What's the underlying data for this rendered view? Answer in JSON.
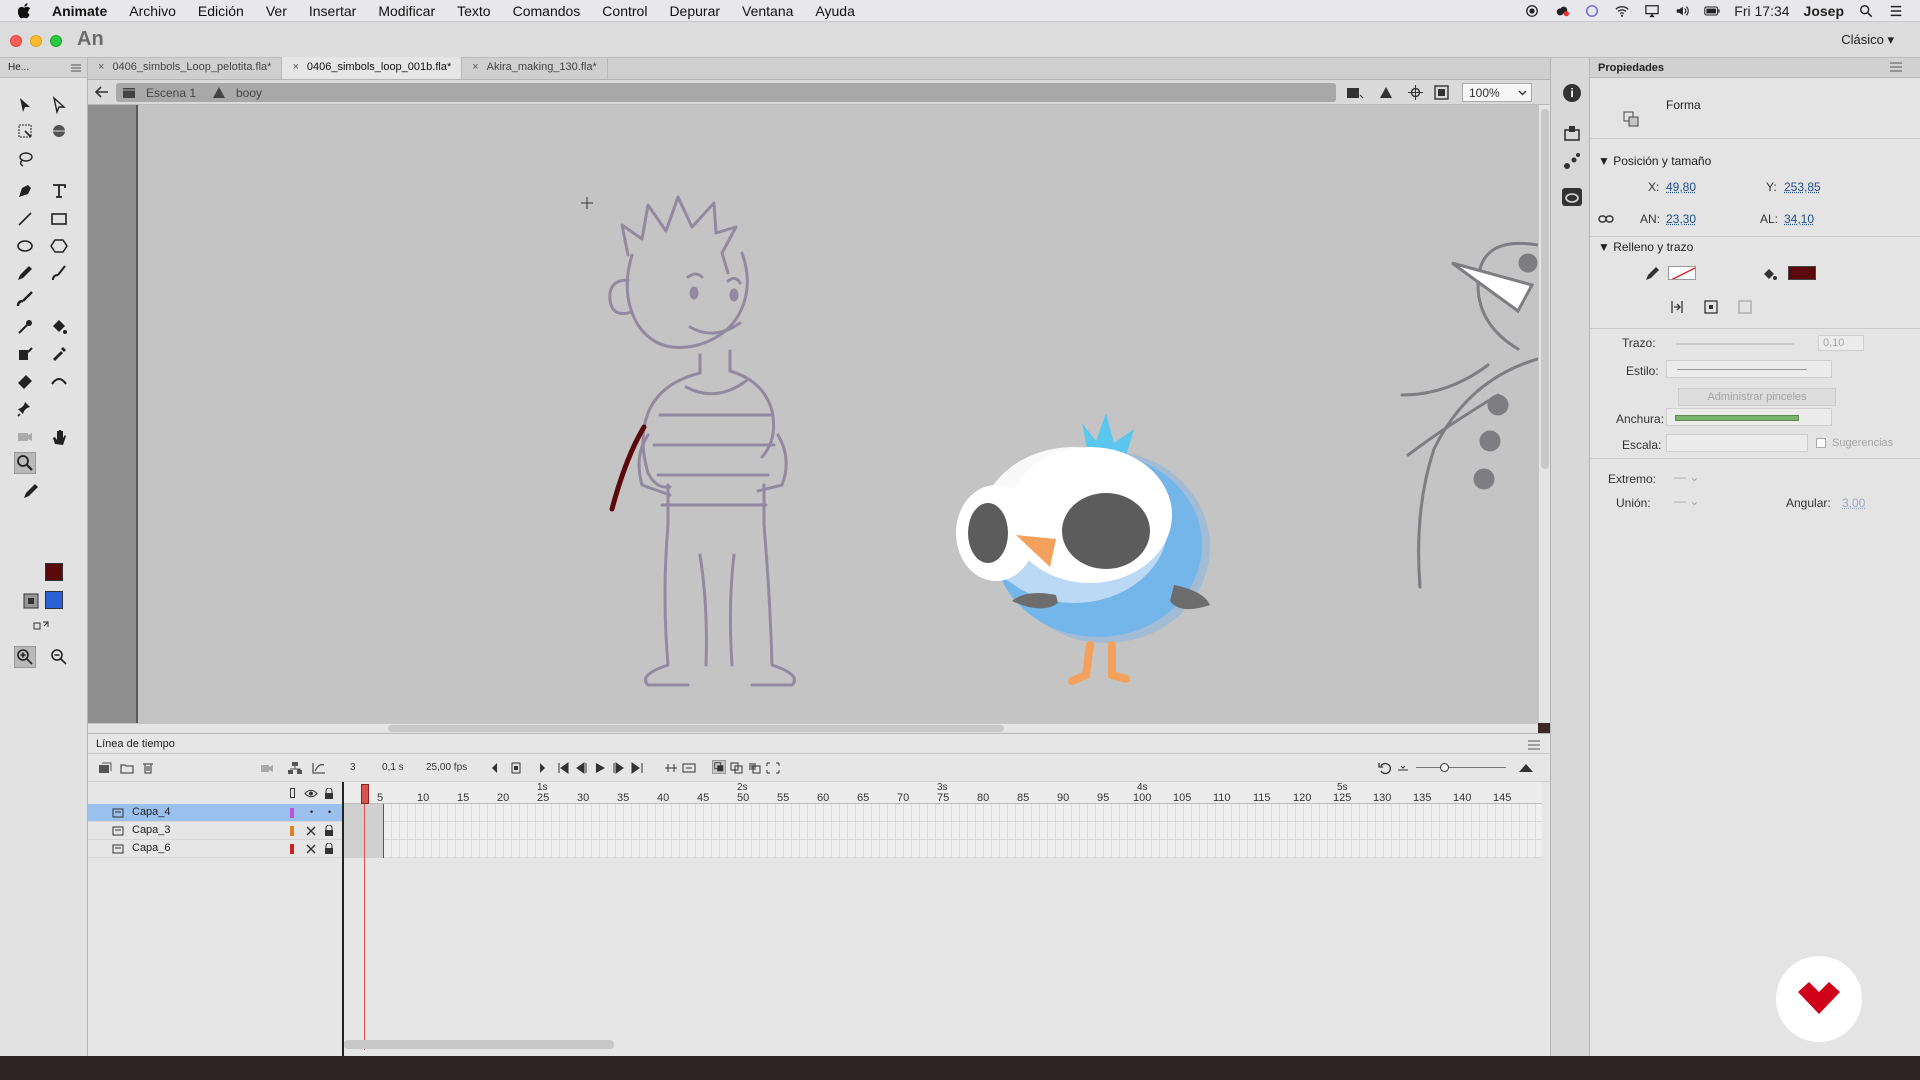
{
  "menubar": {
    "app": "Animate",
    "items": [
      "Archivo",
      "Edición",
      "Ver",
      "Insertar",
      "Modificar",
      "Texto",
      "Comandos",
      "Control",
      "Depurar",
      "Ventana",
      "Ayuda"
    ],
    "clock": "Fri 17:34",
    "user": "Josep"
  },
  "titlebar": {
    "logo": "An",
    "workspace": "Clásico ▾"
  },
  "tools_panel": {
    "header": "He..."
  },
  "tabs": [
    {
      "label": "0406_simbols_Loop_pelotita.fla*",
      "active": false
    },
    {
      "label": "0406_simbols_loop_001b.fla*",
      "active": true
    },
    {
      "label": "Akira_making_130.fla*",
      "active": false
    }
  ],
  "editbar": {
    "scene": "Escena 1",
    "symbol": "booy",
    "zoom": "100%"
  },
  "properties": {
    "tab": "Propiedades",
    "type": "Forma",
    "pos_section": "Posición y tamaño",
    "x_label": "X:",
    "x": "49,80",
    "y_label": "Y:",
    "y": "253,85",
    "w_label": "AN:",
    "w": "23,30",
    "h_label": "AL:",
    "h": "34,10",
    "fill_section": "Relleno y trazo",
    "fill_color": "#5a0a0a",
    "trazo_label": "Trazo:",
    "trazo_value": "0,10",
    "estilo_label": "Estilo:",
    "brushes_button": "Administrar pinceles",
    "anchura_label": "Anchura:",
    "escala_label": "Escala:",
    "hints_label": "Sugerencias",
    "extremo_label": "Extremo:",
    "union_label": "Unión:",
    "angular_label": "Angular:",
    "angular_value": "3,00"
  },
  "timeline": {
    "title": "Línea de tiempo",
    "current_frame": "3",
    "time": "0,1 s",
    "fps": "25,00 fps",
    "seconds": [
      "1s",
      "2s",
      "3s",
      "4s",
      "5s"
    ],
    "ticks": [
      "5",
      "10",
      "15",
      "20",
      "25",
      "30",
      "35",
      "40",
      "45",
      "50",
      "55",
      "60",
      "65",
      "70",
      "75",
      "80",
      "85",
      "90",
      "95",
      "100",
      "105",
      "110",
      "115",
      "120",
      "125",
      "130",
      "135",
      "140",
      "145"
    ],
    "layers": [
      {
        "name": "Capa_4",
        "color": "#c050e0",
        "selected": true
      },
      {
        "name": "Capa_3",
        "color": "#e08020",
        "selected": false
      },
      {
        "name": "Capa_6",
        "color": "#d02020",
        "selected": false
      }
    ]
  },
  "colors": {
    "stroke_swatch": "#5a0a0a",
    "fill_swatch": "#2a62d6",
    "brand_logo": "#d0021b"
  }
}
